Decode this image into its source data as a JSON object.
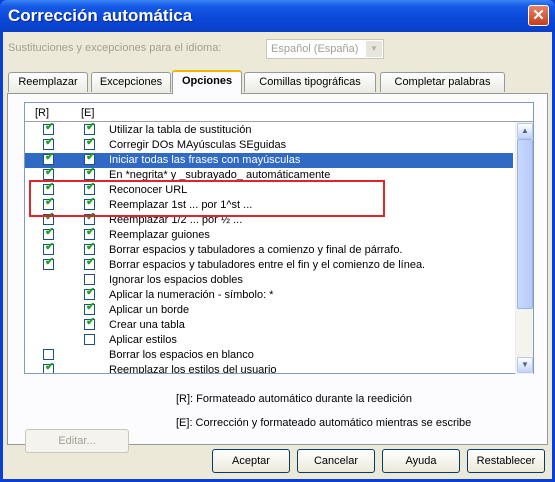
{
  "window": {
    "title": "Corrección automática",
    "close_label": "✕"
  },
  "language": {
    "label": "Sustituciones y excepciones para el idioma:",
    "value": "Español (España)"
  },
  "tabs": [
    {
      "label": "Reemplazar"
    },
    {
      "label": "Excepciones"
    },
    {
      "label": "Opciones"
    },
    {
      "label": "Comillas tipográficas"
    },
    {
      "label": "Completar palabras"
    }
  ],
  "list": {
    "col_r": "[R]",
    "col_e": "[E]",
    "rows": [
      {
        "r": true,
        "e": true,
        "label": "Utilizar la tabla de sustitución"
      },
      {
        "r": true,
        "e": true,
        "label": "Corregir DOs MAyúsculas SEguidas"
      },
      {
        "r": true,
        "e": true,
        "label": "Iniciar todas las frases con mayúsculas",
        "selected": true
      },
      {
        "r": true,
        "e": true,
        "label": "En *negrita* y _subrayado_ automáticamente"
      },
      {
        "r": true,
        "e": true,
        "label": "Reconocer URL"
      },
      {
        "r": true,
        "e": true,
        "label": "Reemplazar 1st ... por 1^st ..."
      },
      {
        "r": true,
        "e": true,
        "label": "Reemplazar 1/2 ... por ½ ..."
      },
      {
        "r": true,
        "e": true,
        "label": "Reemplazar guiones"
      },
      {
        "r": true,
        "e": true,
        "label": "Borrar espacios y tabuladores a comienzo y final de párrafo."
      },
      {
        "r": true,
        "e": true,
        "label": "Borrar espacios y tabuladores entre el fin y el comienzo de línea."
      },
      {
        "r": null,
        "e": false,
        "label": "Ignorar los espacios dobles"
      },
      {
        "r": null,
        "e": true,
        "label": "Aplicar la numeración - símbolo: *"
      },
      {
        "r": null,
        "e": true,
        "label": "Aplicar un borde"
      },
      {
        "r": null,
        "e": true,
        "label": "Crear una tabla"
      },
      {
        "r": null,
        "e": false,
        "label": "Aplicar estilos"
      },
      {
        "r": false,
        "e": null,
        "label": "Borrar los espacios en blanco"
      },
      {
        "r": true,
        "e": null,
        "label": "Reemplazar los estilos del usuario"
      }
    ]
  },
  "edit_button": "Editar...",
  "legend_r": "[R]: Formateado automático durante la reedición",
  "legend_e": "[E]: Corrección y formateado automático mientras se escribe",
  "buttons": {
    "ok": "Aceptar",
    "cancel": "Cancelar",
    "help": "Ayuda",
    "reset": "Restablecer"
  },
  "icons": {
    "close": "close-icon",
    "dropdown": "chevron-down-icon",
    "check": "checkmark-icon"
  }
}
